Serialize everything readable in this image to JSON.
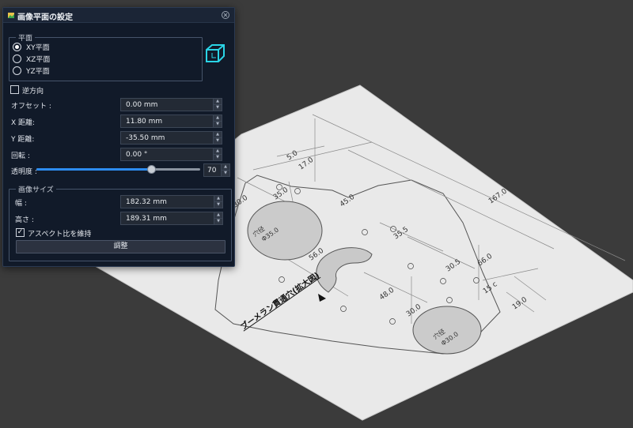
{
  "panel": {
    "title": "画像平面の設定",
    "plane_group": {
      "legend": "平面",
      "options": [
        "XY平面",
        "XZ平面",
        "YZ平面"
      ],
      "selected": "XY平面"
    },
    "reverse_label": "逆方向",
    "reverse_checked": false,
    "fields": {
      "offset": {
        "label": "オフセット :",
        "value": "0.00 mm"
      },
      "x_distance": {
        "label": "X 距離:",
        "value": "11.80 mm"
      },
      "y_distance": {
        "label": "Y 距離:",
        "value": "-35.50 mm"
      },
      "rotation": {
        "label": "回転 :",
        "value": "0.00 °"
      }
    },
    "opacity": {
      "label": "透明度 :",
      "value": "70",
      "level_percent": 70
    },
    "image_size": {
      "legend": "画像サイズ",
      "width": {
        "label": "幅 :",
        "value": "182.32 mm"
      },
      "height": {
        "label": "高さ :",
        "value": "189.31 mm"
      },
      "keep_aspect_label": "アスペクト比を維持",
      "keep_aspect_checked": true
    },
    "adjust_label": "調整"
  },
  "drawing": {
    "dimensions": [
      "5.0",
      "17.0",
      "30.0",
      "35.0",
      "45.0",
      "167.0",
      "35.5",
      "56.0",
      "30.5",
      "66.0",
      "48.0",
      "15 c",
      "19.0",
      "30.0"
    ],
    "holes": [
      {
        "label": "穴径",
        "dia": "Φ35.0"
      },
      {
        "label": "穴径",
        "dia": "Φ30.0"
      }
    ],
    "caption": "ブーメラン貫通穴(拡大図)"
  },
  "colors": {
    "accent": "#2d8cf0",
    "panel_bg": "#111a29",
    "viewport_bg": "#3b3b3b",
    "cube_icon": "#2ad4e6"
  }
}
